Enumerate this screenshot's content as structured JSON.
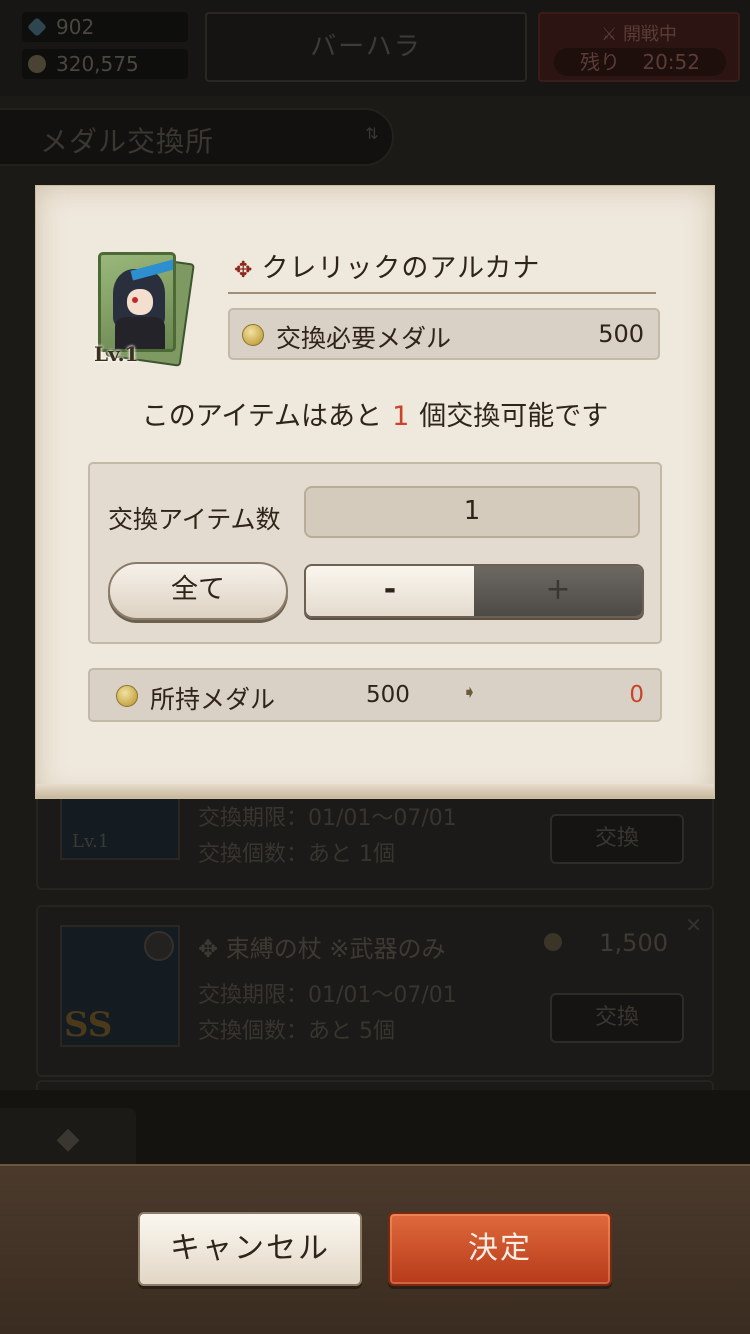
{
  "header": {
    "gems": "902",
    "gold": "320,575",
    "area_name": "バーハラ",
    "battle_status": "開戦中",
    "battle_remaining_label": "残り",
    "battle_remaining_time": "20:52"
  },
  "page": {
    "title": "メダル交換所"
  },
  "background_list": {
    "items": [
      {
        "level": "Lv.1",
        "period": "交換期限：01/01～07/01",
        "count": "交換個数：あと 1個",
        "button": "交換"
      },
      {
        "name": "✥ 束縛の杖 ※武器のみ",
        "price": "1,500",
        "rank": "SS",
        "period": "交換期限：01/01～07/01",
        "count": "交換個数：あと 5個",
        "button": "交換"
      }
    ]
  },
  "dialog": {
    "item_name": "クレリックのアルカナ",
    "item_level": "Lv.1",
    "required_label": "交換必要メダル",
    "required_value": "500",
    "notice_before": "このアイテムはあと",
    "notice_count": "1",
    "notice_after": "個交換可能です",
    "quantity_label": "交換アイテム数",
    "quantity_value": "1",
    "all_button": "全て",
    "minus_button": "-",
    "plus_button": "+",
    "owned_label": "所持メダル",
    "owned_current": "500",
    "owned_after": "0"
  },
  "footer": {
    "cancel": "キャンセル",
    "confirm": "決定"
  },
  "colors": {
    "accent_red": "#c8442a",
    "confirm_button": "#c24a22",
    "parchment": "#efe8dc"
  }
}
